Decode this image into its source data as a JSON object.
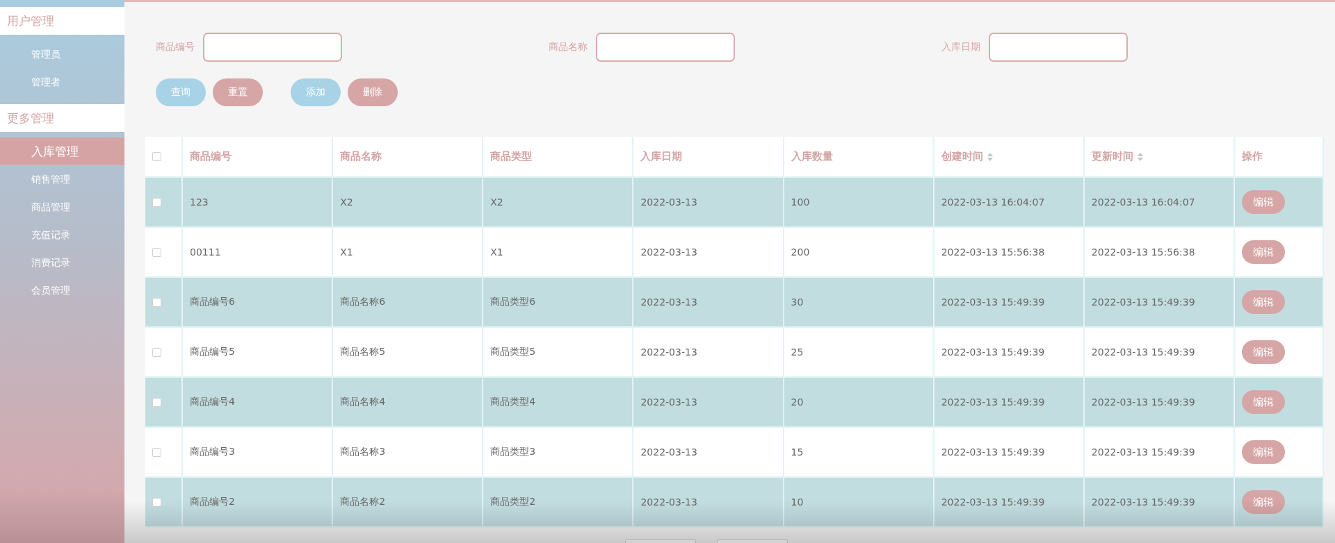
{
  "sidebar": {
    "groups": [
      {
        "title": "用户管理",
        "items": [
          {
            "label": "管理员",
            "selected": false
          },
          {
            "label": "管理者",
            "selected": false
          }
        ]
      },
      {
        "title": "更多管理",
        "items": [
          {
            "label": "入库管理",
            "selected": true
          },
          {
            "label": "销售管理",
            "selected": false
          },
          {
            "label": "商品管理",
            "selected": false
          },
          {
            "label": "充值记录",
            "selected": false
          },
          {
            "label": "消费记录",
            "selected": false
          },
          {
            "label": "会员管理",
            "selected": false
          }
        ]
      }
    ]
  },
  "filters": [
    {
      "label": "商品编号"
    },
    {
      "label": "商品名称"
    },
    {
      "label": "入库日期"
    }
  ],
  "buttons": [
    {
      "label": "查询",
      "kind": "primary"
    },
    {
      "label": "重置",
      "kind": "secondary"
    },
    {
      "label": "添加",
      "kind": "primary"
    },
    {
      "label": "删除",
      "kind": "secondary"
    }
  ],
  "table": {
    "select_all_checked": false,
    "columns": [
      {
        "label": "商品编号",
        "sortable": false
      },
      {
        "label": "商品名称",
        "sortable": false
      },
      {
        "label": "商品类型",
        "sortable": false
      },
      {
        "label": "入库日期",
        "sortable": false
      },
      {
        "label": "入库数量",
        "sortable": false
      },
      {
        "label": "创建时间",
        "sortable": true
      },
      {
        "label": "更新时间",
        "sortable": true
      },
      {
        "label": "操作",
        "sortable": false
      }
    ],
    "rows": [
      {
        "checked": false,
        "cells": [
          "123",
          "X2",
          "X2",
          "2022-03-13",
          "100",
          "2022-03-13 16:04:07",
          "2022-03-13 16:04:07"
        ],
        "action": "编辑"
      },
      {
        "checked": false,
        "cells": [
          "00111",
          "X1",
          "X1",
          "2022-03-13",
          "200",
          "2022-03-13 15:56:38",
          "2022-03-13 15:56:38"
        ],
        "action": "编辑"
      },
      {
        "checked": false,
        "cells": [
          "商品编号6",
          "商品名称6",
          "商品类型6",
          "2022-03-13",
          "30",
          "2022-03-13 15:49:39",
          "2022-03-13 15:49:39"
        ],
        "action": "编辑"
      },
      {
        "checked": false,
        "cells": [
          "商品编号5",
          "商品名称5",
          "商品类型5",
          "2022-03-13",
          "25",
          "2022-03-13 15:49:39",
          "2022-03-13 15:49:39"
        ],
        "action": "编辑"
      },
      {
        "checked": false,
        "cells": [
          "商品编号4",
          "商品名称4",
          "商品类型4",
          "2022-03-13",
          "20",
          "2022-03-13 15:49:39",
          "2022-03-13 15:49:39"
        ],
        "action": "编辑"
      },
      {
        "checked": false,
        "cells": [
          "商品编号3",
          "商品名称3",
          "商品类型3",
          "2022-03-13",
          "15",
          "2022-03-13 15:49:39",
          "2022-03-13 15:49:39"
        ],
        "action": "编辑"
      },
      {
        "checked": false,
        "cells": [
          "商品编号2",
          "商品名称2",
          "商品类型2",
          "2022-03-13",
          "10",
          "2022-03-13 15:49:39",
          "2022-03-13 15:49:39"
        ],
        "action": "编辑"
      }
    ]
  }
}
